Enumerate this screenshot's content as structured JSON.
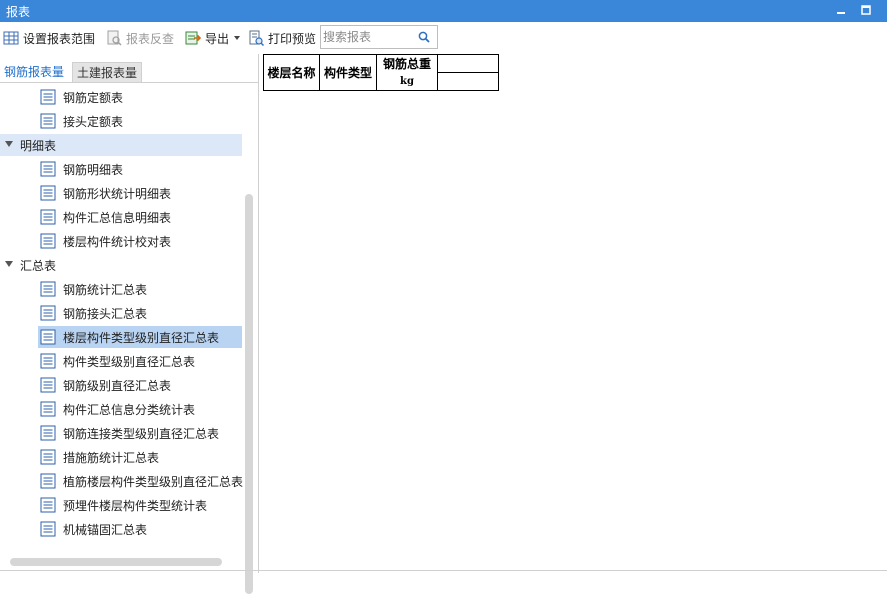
{
  "window": {
    "title": "报表"
  },
  "toolbar": {
    "set_range": "设置报表范围",
    "reverse": "报表反查",
    "export": "导出",
    "print_preview": "打印预览",
    "search_placeholder": "搜索报表",
    "search_value": ""
  },
  "tabs": [
    {
      "label": "钢筋报表量",
      "active": true
    },
    {
      "label": "土建报表量",
      "active": false
    }
  ],
  "tree": {
    "top_items": [
      "钢筋定额表",
      "接头定额表"
    ],
    "groups": [
      {
        "label": "明细表",
        "selected": true,
        "items": [
          "钢筋明细表",
          "钢筋形状统计明细表",
          "构件汇总信息明细表",
          "楼层构件统计校对表"
        ]
      },
      {
        "label": "汇总表",
        "selected": false,
        "items": [
          "钢筋统计汇总表",
          "钢筋接头汇总表",
          "楼层构件类型级别直径汇总表",
          "构件类型级别直径汇总表",
          "钢筋级别直径汇总表",
          "构件汇总信息分类统计表",
          "钢筋连接类型级别直径汇总表",
          "措施筋统计汇总表",
          "植筋楼层构件类型级别直径汇总表",
          "预埋件楼层构件类型统计表",
          "机械锚固汇总表"
        ]
      }
    ],
    "selected_item": "楼层构件类型级别直径汇总表"
  },
  "report": {
    "headers": [
      "楼层名称",
      "构件类型",
      "钢筋总重"
    ],
    "unit": "kg"
  },
  "colors": {
    "titlebar": "#3a87d9",
    "active_tab": "#1e6fcf",
    "group_selected": "#dce8f8",
    "item_selected": "#b9d4f2"
  }
}
